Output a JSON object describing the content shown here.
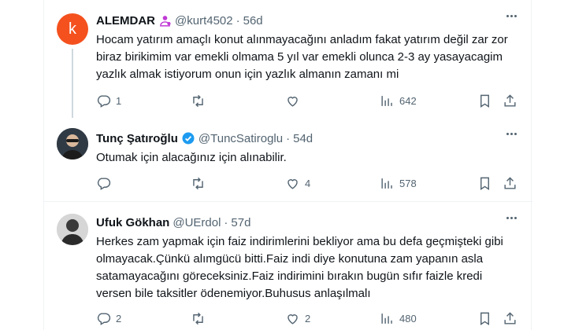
{
  "tweets": [
    {
      "avatar_letter": "k",
      "name": "ALEMDAR",
      "handle": "@kurt4502",
      "time": "56d",
      "text": "Hocam yatırım amaçlı konut alınmayacağını anladım fakat yatırım değil zar zor biraz birikimim var emekli olmama 5 yıl var emekli olunca 2-3 ay yasayacagim yazlık almak istiyorum onun için yazlık almanın zamanı mi",
      "replies": "1",
      "retweets": "",
      "likes": "",
      "views": "642"
    },
    {
      "name": "Tunç Şatıroğlu",
      "handle": "@TuncSatiroglu",
      "time": "54d",
      "text": "Otumak için alacağınız için alınabilir.",
      "replies": "",
      "retweets": "",
      "likes": "4",
      "views": "578"
    },
    {
      "name": "Ufuk Gökhan",
      "handle": "@UErdol",
      "time": "57d",
      "text": "Herkes zam yapmak için faiz indirimlerini bekliyor ama bu defa geçmişteki gibi olmayacak.Çünkü alımgücü bitti.Faiz indi diye konutuna zam yapanın asla satamayacağını göreceksiniz.Faiz indirimini bırakın bugün sıfır faizle kredi versen bile taksitler ödenemiyor.Buhusus anlaşılmalı",
      "replies": "2",
      "retweets": "",
      "likes": "2",
      "views": "480"
    }
  ],
  "separator": "·",
  "colors": {
    "text": "#0f1419",
    "secondary": "#536471",
    "verified": "#1d9bf0",
    "avatar_k": "#f4511e",
    "thread_line": "#cfd9de"
  },
  "icons": [
    "reply-icon",
    "retweet-icon",
    "like-icon",
    "views-icon",
    "bookmark-icon",
    "share-icon",
    "more-icon",
    "verified-badge-icon",
    "subscriber-badge-icon"
  ]
}
